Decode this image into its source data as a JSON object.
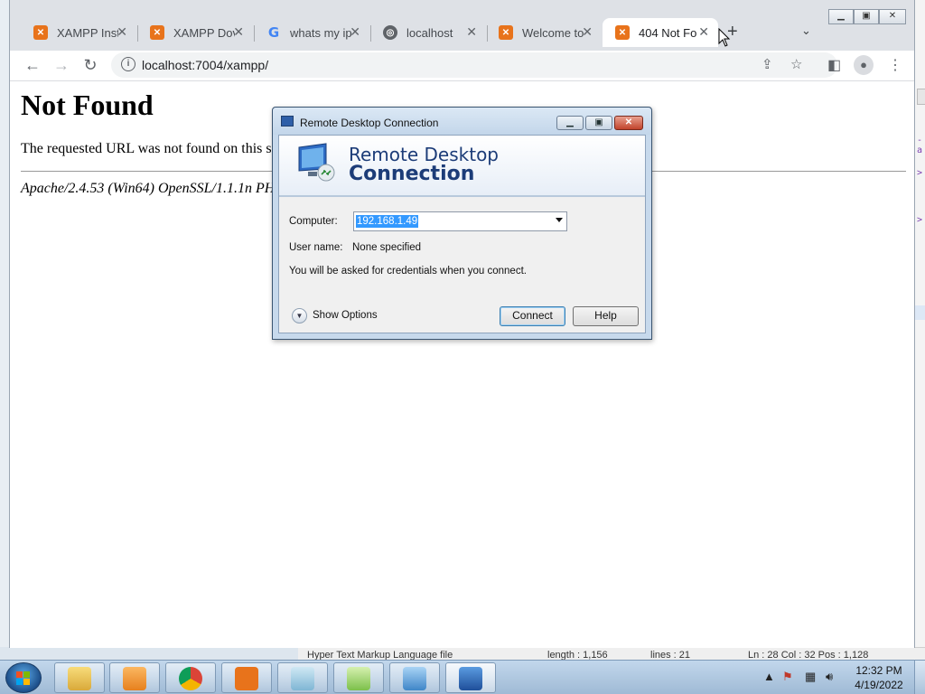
{
  "browser": {
    "tabs": [
      {
        "title": "XAMPP Inst",
        "icon": "xampp-icon"
      },
      {
        "title": "XAMPP Dov",
        "icon": "xampp-icon"
      },
      {
        "title": "whats my ip",
        "icon": "google-icon"
      },
      {
        "title": "localhost",
        "icon": "globe-icon"
      },
      {
        "title": "Welcome to",
        "icon": "xampp-icon"
      },
      {
        "title": "404 Not Fo",
        "icon": "xampp-icon",
        "active": true
      }
    ],
    "url": "localhost:7004/xampp/",
    "close_glyph": "✕",
    "newtab_glyph": "+"
  },
  "page": {
    "heading": "Not Found",
    "message": "The requested URL was not found on this server.",
    "address": "Apache/2.4.53 (Win64) OpenSSL/1.1.1n PHP/8.1.5 Server at localhost Port 7004"
  },
  "dialog": {
    "title": "Remote Desktop Connection",
    "banner_line1": "Remote Desktop",
    "banner_line2": "Connection",
    "computer_label": "Computer:",
    "computer_value": "192.168.1.49",
    "username_label": "User name:",
    "username_value": "None specified",
    "credentials_note": "You will be asked for credentials when you connect.",
    "show_options": "Show Options",
    "connect": "Connect",
    "help": "Help"
  },
  "background_app": {
    "status": {
      "file_type": "Hyper Text Markup Language file",
      "length": "length : 1,156",
      "lines": "lines : 21",
      "position": "Ln : 28    Col : 32    Pos : 1,128"
    }
  },
  "taskbar": {
    "time": "12:32 PM",
    "date": "4/19/2022",
    "items": [
      "explorer",
      "media-player",
      "chrome",
      "xampp",
      "notepad",
      "notepad-plus-plus",
      "control-panel",
      "remote-desktop"
    ]
  },
  "colors": {
    "xampp_orange": "#e8731b",
    "rdc_title_blue": "#1c3c78",
    "selection_blue": "#3399ff"
  }
}
